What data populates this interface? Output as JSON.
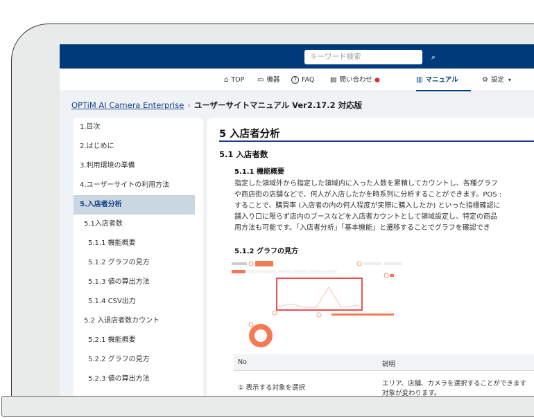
{
  "header": {
    "search": {
      "placeholder": "キーワード検索",
      "icon": "search-icon"
    }
  },
  "nav": {
    "items": [
      {
        "label": "TOP",
        "icon": "home-icon",
        "glyph": "⌂"
      },
      {
        "label": "機器",
        "icon": "devices-icon",
        "glyph": "▭"
      },
      {
        "label": "FAQ",
        "icon": "help-icon",
        "glyph": "?"
      },
      {
        "label": "問い合わせ",
        "icon": "chat-icon",
        "glyph": "▤",
        "notification_dot": "●"
      },
      {
        "label": "マニュアル",
        "icon": "book-icon",
        "glyph": "▥",
        "active": true
      },
      {
        "label": "設定",
        "icon": "gear-icon",
        "glyph": "⚙",
        "dropdown": "▾"
      }
    ]
  },
  "breadcrumb": {
    "root": "OPTiM AI Camera Enterprise",
    "separator": "›",
    "current": "ユーザーサイトマニュアル Ver2.17.2 対応版"
  },
  "sidebar": {
    "items": [
      {
        "label": "1.目次",
        "level": 0
      },
      {
        "label": "2.はじめに",
        "level": 0
      },
      {
        "label": "3.利用環境の準備",
        "level": 0
      },
      {
        "label": "4.ユーザーサイトの利用方法",
        "level": 0
      },
      {
        "label": "5.入店者分析",
        "level": 0,
        "active": true
      },
      {
        "label": "5.1入店者数",
        "level": 1
      },
      {
        "label": "5.1.1 機能概要",
        "level": 2
      },
      {
        "label": "5.1.2 グラフの見方",
        "level": 2
      },
      {
        "label": "5.1.3 値の算出方法",
        "level": 2
      },
      {
        "label": "5.1.4 CSV出力",
        "level": 2
      },
      {
        "label": "5.2 入退店者数カウント",
        "level": 1
      },
      {
        "label": "5.2.1 機能概要",
        "level": 2
      },
      {
        "label": "5.2.2 グラフの見方",
        "level": 2
      },
      {
        "label": "5.2.3 値の算出方法",
        "level": 2
      }
    ]
  },
  "main": {
    "h1": "5 入店者分析",
    "h2": "5.1 入店者数",
    "h3_overview": "5.1.1 機能概要",
    "paragraph_lines": [
      "指定した領域外から指定した領域内に入った人数を累積してカウントし、各種グラフ",
      "や商店街の店舗などで、何人が入店したかを時系列に分析することができます。POS :",
      "することで、購買率 (入店者の内の何人程度が実際に購入したか) といった指標確認に",
      "舗入り口に限らず店内のブースなどを入店者カウントとして領域設定し、特定の商品",
      "用方法も可能です。「入店者分析」「基本機能」と遷移することでグラフを確認でき"
    ],
    "h3_graph": "5.1.2 グラフの見方",
    "screenshot_alt": "入店者数グラフ画面のスクリーンショット",
    "table": {
      "headers": [
        "No",
        "説明"
      ],
      "rows": [
        [
          "① 表示する対象を選択",
          "エリア、店舗、カメラを選択することができます",
          "対象が変わります。"
        ]
      ]
    }
  },
  "colors": {
    "brand_navy": "#003a7a",
    "accent_orange": "#f47a55",
    "highlight_red": "#e8242c",
    "notification_red": "#e22b2b"
  }
}
